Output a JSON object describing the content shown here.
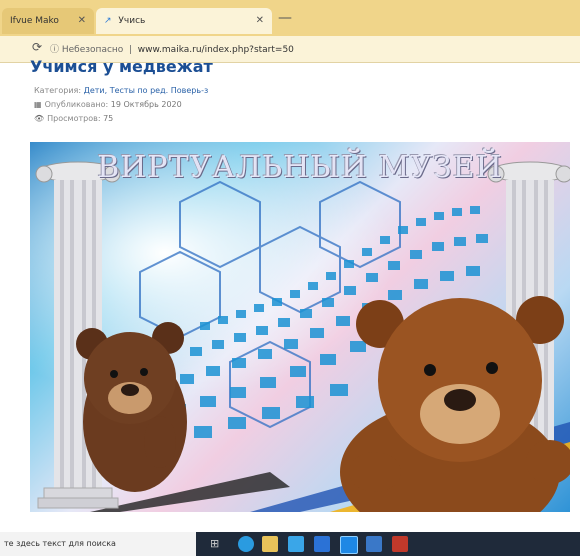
{
  "browser": {
    "tabs": [
      {
        "label": "Ifvue Mako"
      },
      {
        "label": "Учись"
      }
    ],
    "address": {
      "security": "Небезопасно",
      "url": "www.maika.ru/index.php?start=50"
    }
  },
  "article": {
    "title": "Учимся у медвежат",
    "category_label": "Категория:",
    "category_value": "Дети, Тесты по ред. Поверь-з",
    "published_label": "Опубликовано:",
    "published_value": "19 Октябрь 2020",
    "views_label": "Просмотров:",
    "views_value": "75"
  },
  "banner": {
    "title": "ВИРТУАЛЬНЫЙ МУЗЕЙ"
  },
  "taskbar": {
    "search_placeholder": "те здесь текст для поиска"
  },
  "colors": {
    "tab_strip": "#f0d58a",
    "title_blue": "#1c4f94",
    "taskbar": "#1f2a3a"
  },
  "icons": [
    "refresh-icon",
    "info-icon",
    "calendar-icon",
    "eye-icon",
    "close-icon",
    "new-tab-icon",
    "windows-icon",
    "edge-icon",
    "files-icon",
    "store-icon",
    "mail-icon"
  ]
}
